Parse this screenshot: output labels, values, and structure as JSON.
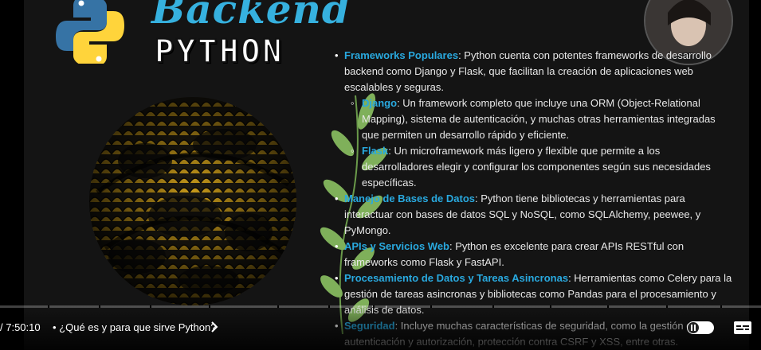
{
  "slide": {
    "brand_script": "Backend",
    "brand_title": "PYTHON",
    "items": [
      {
        "keyword": "Frameworks Populares",
        "text": ": Python cuenta con potentes frameworks de desarrollo backend como Django y Flask, que facilitan la creación de aplicaciones web escalables y seguras.",
        "children": [
          {
            "keyword": "Django",
            "text": ": Un framework completo que incluye una ORM (Object-Relational Mapping), sistema de autenticación, y muchas otras herramientas integradas que permiten un desarrollo rápido y eficiente."
          },
          {
            "keyword": "Flask",
            "text": ": Un microframework más ligero y flexible que permite a los desarrolladores elegir y configurar los componentes según sus necesidades específicas."
          }
        ]
      },
      {
        "keyword": "Manejo de Bases de Datos",
        "text": ": Python tiene bibliotecas y herramientas para interactuar con bases de datos SQL y NoSQL, como SQLAlchemy, peewee, y PyMongo."
      },
      {
        "keyword": "APIs y Servicios Web",
        "text": ": Python es excelente para crear APIs RESTful con frameworks como Flask y FastAPI."
      },
      {
        "keyword": "Procesamiento de Datos y Tareas Asincronas",
        "text": ": Herramientas como Celery para la gestión de tareas asincronas y bibliotecas como Pandas para el procesamiento y análisis de datos."
      },
      {
        "keyword": "Seguridad",
        "text": ": Incluye muchas características de seguridad, como la gestión de autenticación y autorización, protección contra CSRF y XSS, entre otras."
      }
    ]
  },
  "player": {
    "time": "/ 7:50:10",
    "chapter": "•  ¿Qué es y para que sirve Python?",
    "progress_fraction": 0.0
  },
  "icons": {
    "chevron": "chevron-right-icon",
    "autoplay": "autoplay-toggle-icon",
    "captions": "captions-icon"
  },
  "colors": {
    "accent": "#29a9df",
    "python_blue": "#3673a5",
    "python_yellow": "#ffd43b"
  }
}
